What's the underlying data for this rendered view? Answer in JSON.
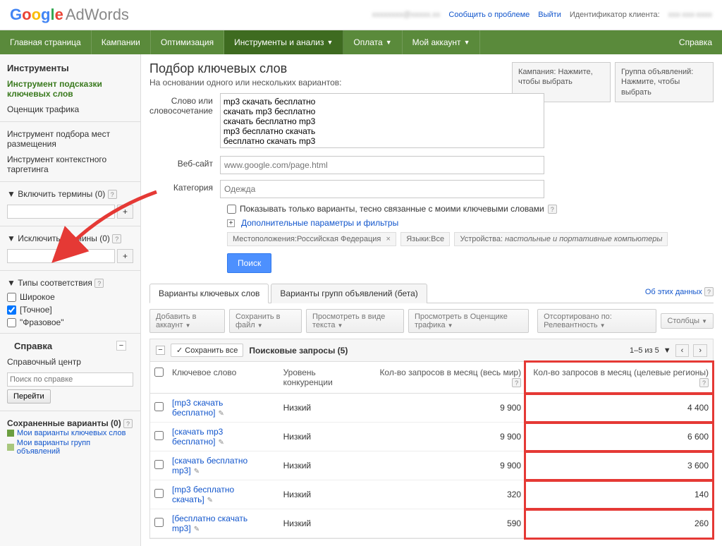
{
  "header": {
    "report_link": "Сообщить о проблеме",
    "logout": "Выйти",
    "client_id_label": "Идентификатор клиента:"
  },
  "nav": {
    "home": "Главная страница",
    "campaigns": "Кампании",
    "optimization": "Оптимизация",
    "tools": "Инструменты и анализ",
    "billing": "Оплата",
    "account": "Мой аккаунт",
    "help": "Справка"
  },
  "sidebar": {
    "tools_title": "Инструменты",
    "keyword_tool": "Инструмент подсказки ключевых слов",
    "traffic_estimator": "Оценщик трафика",
    "placement_tool": "Инструмент подбора мест размещения",
    "contextual_tool": "Инструмент контекстного таргетинга",
    "include_terms": "Включить термины (0)",
    "exclude_terms": "Исключить термины (0)",
    "match_types_title": "Типы соответствия",
    "broad": "Широкое",
    "exact": "[Точное]",
    "phrase": "\"Фразовое\"",
    "help_title": "Справка",
    "help_center": "Справочный центр",
    "search_placeholder": "Поиск по справке",
    "go_btn": "Перейти",
    "saved_title": "Сохраненные варианты (0)",
    "my_keyword_ideas": "Мои варианты ключевых слов",
    "my_adgroup_ideas": "Мои варианты групп объявлений"
  },
  "page": {
    "title": "Подбор ключевых слов",
    "subtitle": "На основании одного или нескольких вариантов:",
    "campaign_selector": "Кампания: Нажмите, чтобы выбрать",
    "adgroup_selector": "Группа объявлений: Нажмите, чтобы выбрать",
    "word_label": "Слово или словосочетание",
    "word_value": "mp3 скачать бесплатно\nскачать mp3 бесплатно\nскачать бесплатно mp3\nmp3 бесплатно скачать\nбесплатно скачать mp3",
    "website_label": "Веб-сайт",
    "website_placeholder": "www.google.com/page.html",
    "category_label": "Категория",
    "category_placeholder": "Одежда",
    "show_related": "Показывать только варианты, тесно связанные с моими ключевыми словами",
    "advanced": "Дополнительные параметры и фильтры",
    "chip_location_label": "Местоположения:",
    "chip_location_value": "Российская Федерация",
    "chip_lang_label": "Языки:",
    "chip_lang_value": "Все",
    "chip_device_label": "Устройства:",
    "chip_device_value": "настольные и портативные компьютеры",
    "search_btn": "Поиск",
    "tab_keywords": "Варианты ключевых слов",
    "tab_adgroups": "Варианты групп объявлений (бета)",
    "about_data": "Об этих данных",
    "tb_add": "Добавить в аккаунт",
    "tb_save": "Сохранить в файл",
    "tb_view_text": "Просмотреть в виде текста",
    "tb_view_estimator": "Просмотреть в Оценщике трафика",
    "tb_sort": "Отсортировано по: Релевантность",
    "tb_columns": "Столбцы",
    "save_all": "Сохранить все",
    "queries_title": "Поисковые запросы (5)",
    "pager": "1–5 из 5",
    "col_keyword": "Ключевое слово",
    "col_competition": "Уровень конкуренции",
    "col_global": "Кол-во запросов в месяц (весь мир)",
    "col_local": "Кол-во запросов в месяц (целевые регионы)"
  },
  "rows": [
    {
      "kw": "[mp3 скачать бесплатно]",
      "comp": "Низкий",
      "global": "9 900",
      "local": "4 400"
    },
    {
      "kw": "[скачать mp3 бесплатно]",
      "comp": "Низкий",
      "global": "9 900",
      "local": "6 600"
    },
    {
      "kw": "[скачать бесплатно mp3]",
      "comp": "Низкий",
      "global": "9 900",
      "local": "3 600"
    },
    {
      "kw": "[mp3 бесплатно скачать]",
      "comp": "Низкий",
      "global": "320",
      "local": "140"
    },
    {
      "kw": "[бесплатно скачать mp3]",
      "comp": "Низкий",
      "global": "590",
      "local": "260"
    }
  ]
}
